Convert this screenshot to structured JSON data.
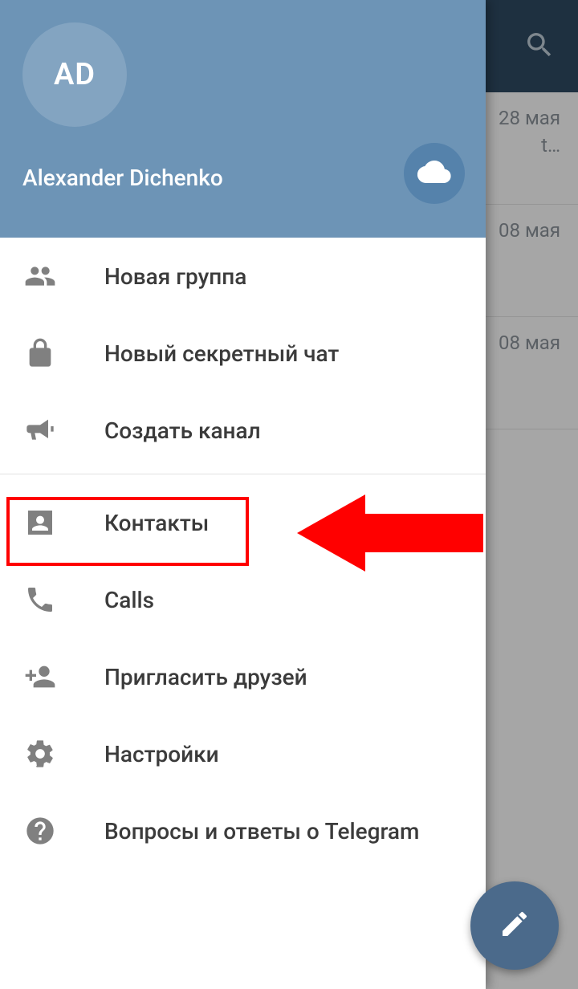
{
  "header": {
    "avatar_initials": "AD",
    "user_name": "Alexander Dichenko"
  },
  "menu": {
    "new_group": "Новая группа",
    "secret_chat": "Новый секретный чат",
    "new_channel": "Создать канал",
    "contacts": "Контакты",
    "calls": "Calls",
    "invite": "Пригласить друзей",
    "settings": "Настройки",
    "faq": "Вопросы и ответы о Telegram"
  },
  "chatlist": {
    "row0_date": "28 мая",
    "row0_badge": "t…",
    "row1_date": "08 мая",
    "row2_date": "08 мая"
  }
}
